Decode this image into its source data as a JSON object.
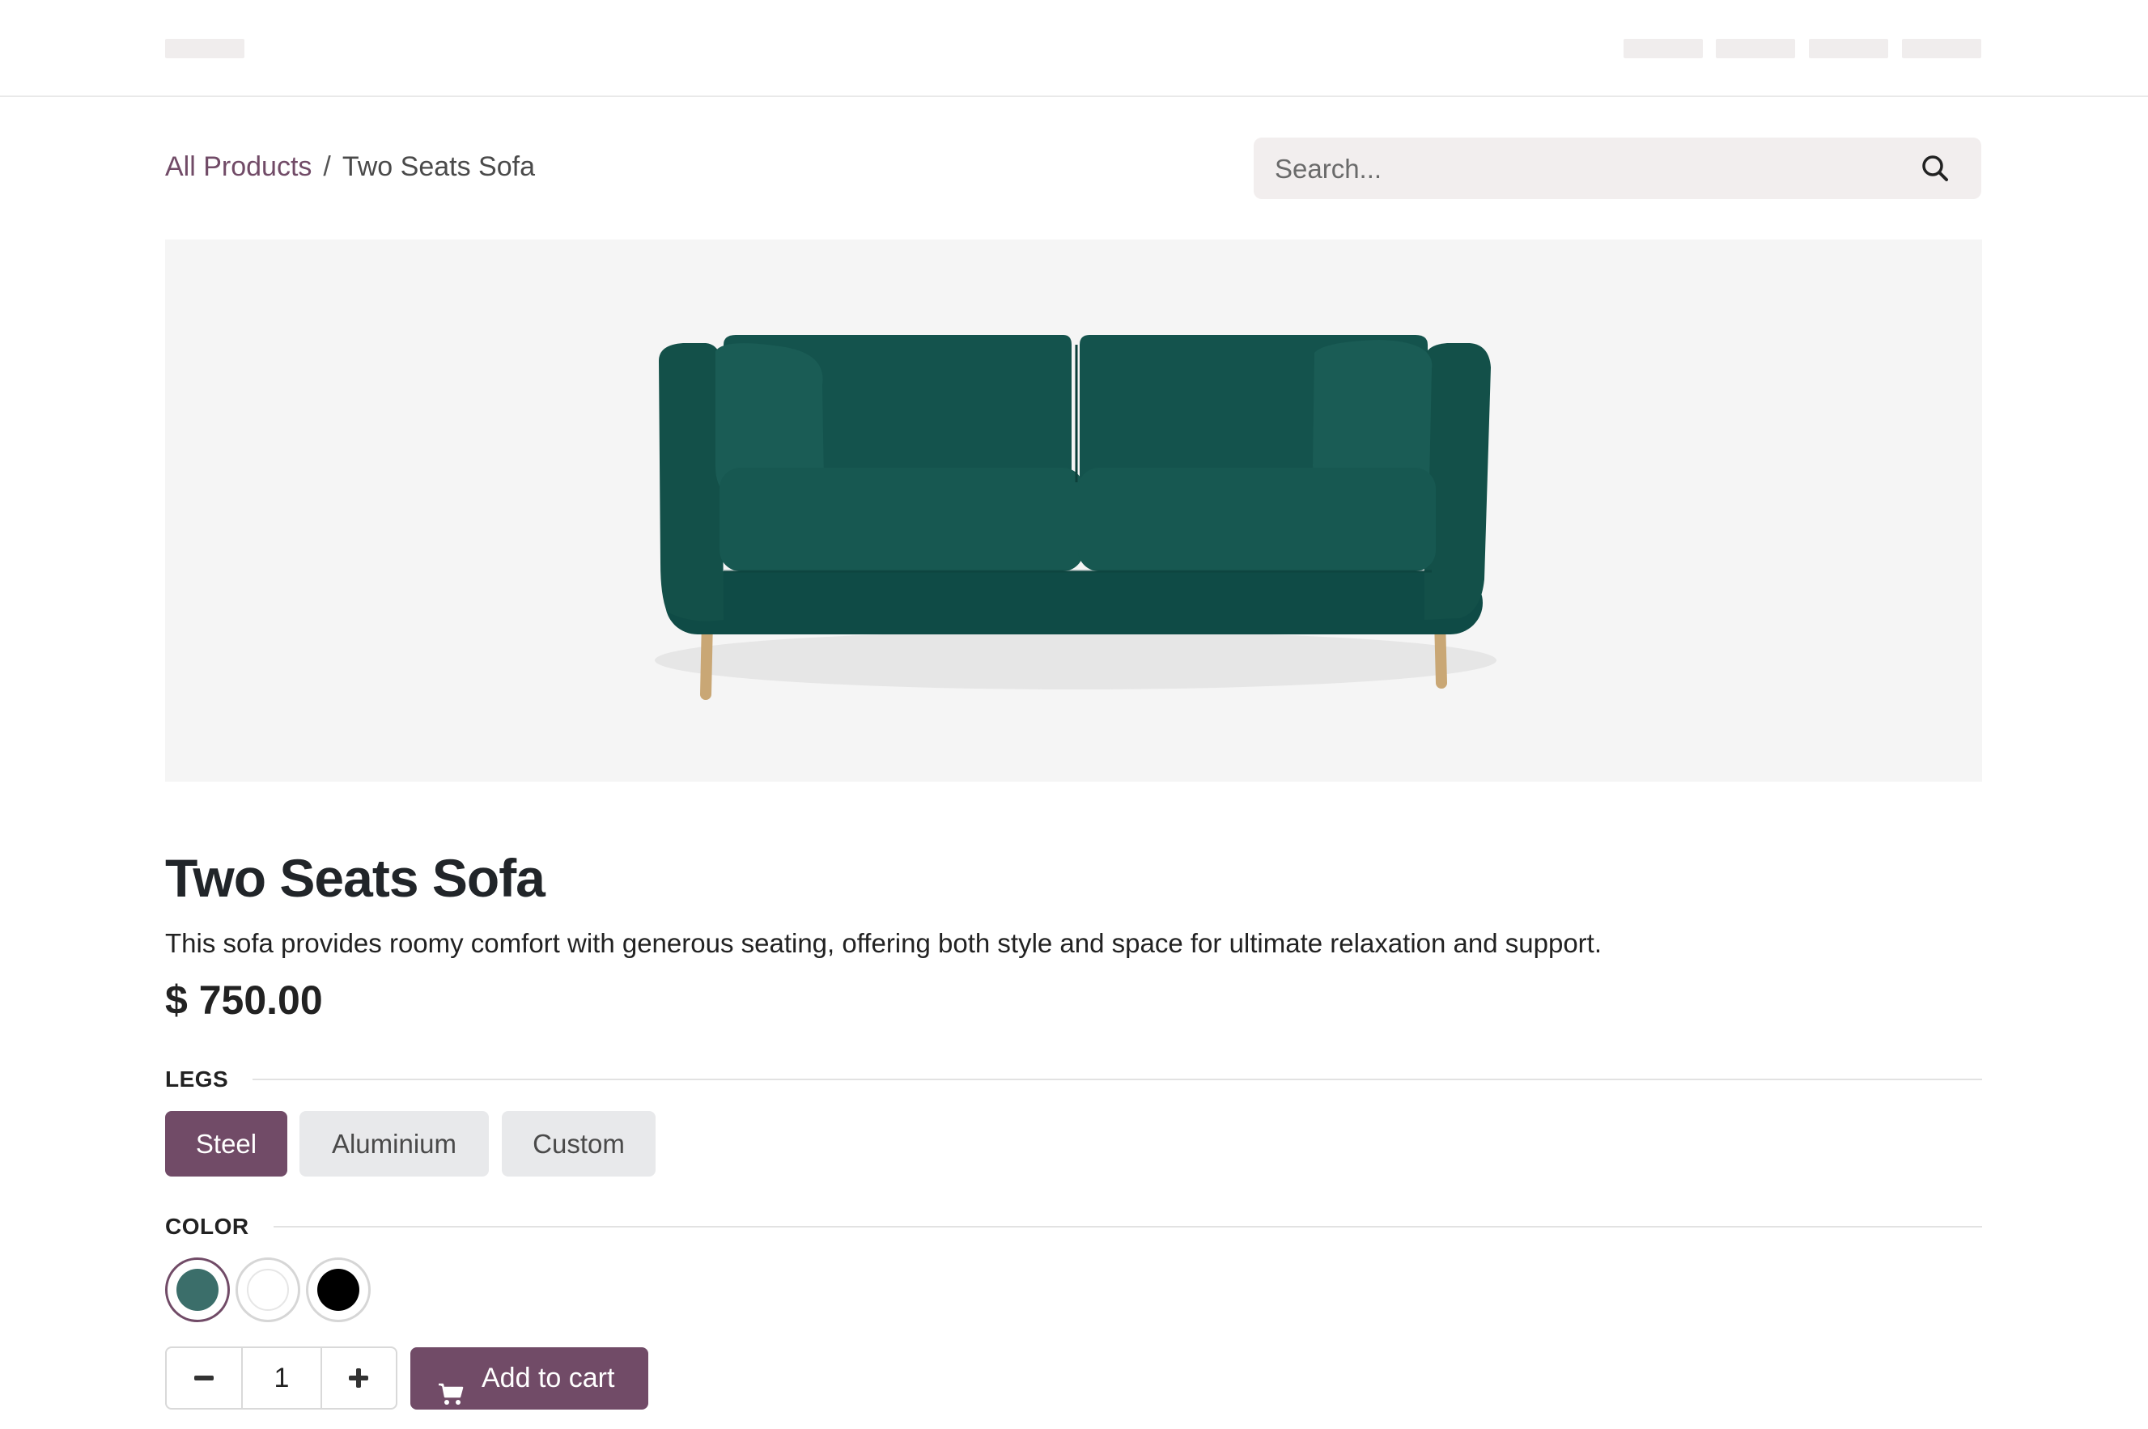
{
  "header": {
    "logo_icon": "logo-placeholder",
    "nav_items": [
      "",
      "",
      "",
      ""
    ]
  },
  "breadcrumb": {
    "root": "All Products",
    "separator": "/",
    "current": "Two Seats Sofa"
  },
  "search": {
    "placeholder": "Search...",
    "icon": "search-icon"
  },
  "product": {
    "image_alt": "green two-seat sofa",
    "title": "Two Seats Sofa",
    "description": "This sofa provides roomy comfort with generous seating, offering both style and space for ultimate relaxation and support.",
    "price": "$ 750.00",
    "legs": {
      "label": "LEGS",
      "options": [
        "Steel",
        "Aluminium",
        "Custom"
      ],
      "selected": "Steel"
    },
    "color": {
      "label": "COLOR",
      "swatches": [
        "#3b6e6a",
        "#ffffff",
        "#000000"
      ],
      "selected_index": 0
    },
    "quantity": "1",
    "add_to_cart": "Add to cart"
  },
  "colors": {
    "accent": "#714b67",
    "search_bg": "#f2eeee",
    "hero_bg": "#f5f5f5"
  }
}
